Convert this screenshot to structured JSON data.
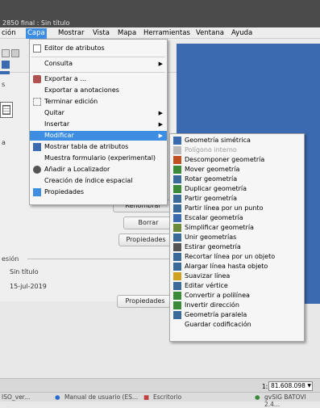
{
  "window": {
    "title": "2850 final : Sin título"
  },
  "menubar": [
    {
      "label": "ción"
    },
    {
      "label": "Capa",
      "active": true
    },
    {
      "label": "Mostrar"
    },
    {
      "label": "Vista"
    },
    {
      "label": "Mapa"
    },
    {
      "label": "Herramientas"
    },
    {
      "label": "Ventana"
    },
    {
      "label": "Ayuda"
    }
  ],
  "left_panel": {
    "texts": {
      "s": "s",
      "a": "a",
      "sesion": "esión",
      "sin_titulo": "Sin título",
      "date": "15-jul-2019"
    }
  },
  "buttons": {
    "renombrar": "Renombrar",
    "borrar": "Borrar",
    "propiedades1": "Propiedades",
    "propiedades2": "Propiedades"
  },
  "capa_menu": [
    {
      "label": "Editor de atributos",
      "icon": "checkbox-icon"
    },
    {
      "label": "Consulta",
      "submenu": true
    },
    {
      "label": "Exportar a ...",
      "icon": "export-icon"
    },
    {
      "label": "Exportar a anotaciones"
    },
    {
      "label": "Terminar edición",
      "icon": "edit-end-icon"
    },
    {
      "label": "Quitar",
      "submenu": true
    },
    {
      "label": "Insertar",
      "submenu": true
    },
    {
      "label": "Modificar",
      "submenu": true,
      "highlighted": true
    },
    {
      "label": "Mostrar tabla de atributos",
      "icon": "table-icon"
    },
    {
      "label": "Muestra formulario (experimental)"
    },
    {
      "label": "Añadir a Localizador",
      "icon": "locator-icon"
    },
    {
      "label": "Creación de índice espacial"
    },
    {
      "label": "Propiedades",
      "icon": "properties-icon"
    }
  ],
  "modificar_menu": [
    {
      "label": "Geometría simétrica",
      "icon": "symmetry-icon"
    },
    {
      "label": "Polígono interno",
      "icon": "polygon-icon",
      "disabled": true
    },
    {
      "label": "Descomponer geometría",
      "icon": "decompose-icon"
    },
    {
      "label": "Mover geometría",
      "icon": "move-icon"
    },
    {
      "label": "Rotar geometría",
      "icon": "rotate-icon"
    },
    {
      "label": "Duplicar geometría",
      "icon": "duplicate-icon"
    },
    {
      "label": "Partir geometría",
      "icon": "split-icon"
    },
    {
      "label": "Partir línea por un punto",
      "icon": "split-line-icon"
    },
    {
      "label": "Escalar geometría",
      "icon": "scale-icon"
    },
    {
      "label": "Simplificar geometría",
      "icon": "simplify-icon"
    },
    {
      "label": "Unir geometrías",
      "icon": "join-icon"
    },
    {
      "label": "Estirar geometría",
      "icon": "stretch-icon"
    },
    {
      "label": "Recortar línea por un objeto",
      "icon": "trim-icon"
    },
    {
      "label": "Alargar línea hasta objeto",
      "icon": "extend-icon"
    },
    {
      "label": "Suavizar línea",
      "icon": "smooth-icon"
    },
    {
      "label": "Editar vértice",
      "icon": "vertex-icon"
    },
    {
      "label": "Convertir a polilínea",
      "icon": "polyline-icon"
    },
    {
      "label": "Invertir dirección",
      "icon": "invert-icon"
    },
    {
      "label": "Geometría paralela",
      "icon": "parallel-icon"
    },
    {
      "label": "Guardar codificación"
    }
  ],
  "status": {
    "scale_prefix": "1:",
    "scale_value": "81.608.098"
  },
  "taskbar": [
    {
      "label": "ISO_ver..."
    },
    {
      "label": "Manual de usuario (ES..."
    },
    {
      "label": "Escritorio"
    },
    {
      "label": "gvSIG BATOVI 2.4..."
    }
  ],
  "colors": {
    "highlight": "#3d8ee2",
    "map": "#3b6ab1",
    "titlebar": "#4b4b4b"
  }
}
